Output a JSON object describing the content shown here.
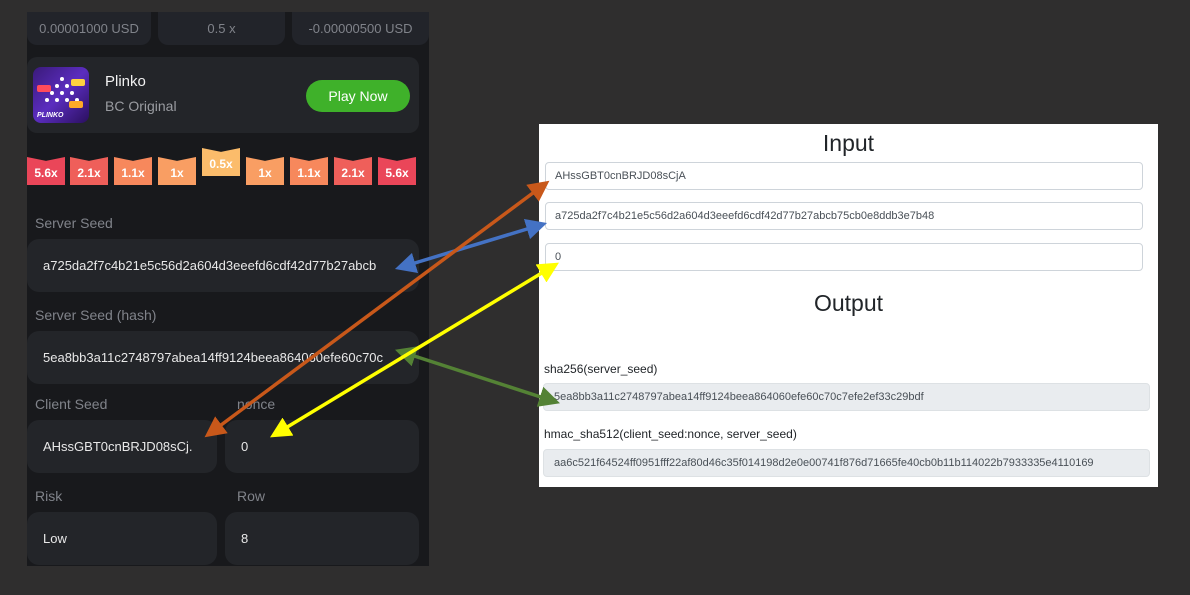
{
  "stats": [
    "0.00001000 USD",
    "0.5 x",
    "-0.00000500 USD"
  ],
  "game": {
    "thumb_label": "PLINKO",
    "title": "Plinko",
    "subtitle": "BC Original",
    "play_label": "Play Now"
  },
  "multipliers": [
    {
      "label": "5.6x",
      "color": "#ea4659"
    },
    {
      "label": "2.1x",
      "color": "#ef5f5a"
    },
    {
      "label": "1.1x",
      "color": "#f7885c"
    },
    {
      "label": "1x",
      "color": "#f99e63"
    },
    {
      "label": "0.5x",
      "color": "#fbbc6b"
    },
    {
      "label": "1x",
      "color": "#f99e63"
    },
    {
      "label": "1.1x",
      "color": "#f7885c"
    },
    {
      "label": "2.1x",
      "color": "#ef5f5a"
    },
    {
      "label": "5.6x",
      "color": "#ea4659"
    }
  ],
  "fields": {
    "server_seed_label": "Server Seed",
    "server_seed_value": "a725da2f7c4b21e5c56d2a604d3eeefd6cdf42d77b27abcb",
    "server_seed_hash_label": "Server Seed (hash)",
    "server_seed_hash_value": "5ea8bb3a11c2748797abea14ff9124beea864060efe60c70c",
    "client_seed_label": "Client Seed",
    "client_seed_value": "AHssGBT0cnBRJD08sCj.",
    "nonce_label": "nonce",
    "nonce_value": "0",
    "risk_label": "Risk",
    "risk_value": "Low",
    "row_label": "Row",
    "row_value": "8"
  },
  "verifier": {
    "input_heading": "Input",
    "client_seed": "AHssGBT0cnBRJD08sCjA",
    "server_seed": "a725da2f7c4b21e5c56d2a604d3eeefd6cdf42d77b27abcb75cb0e8ddb3e7b48",
    "nonce": "0",
    "output_heading": "Output",
    "sha256_label": "sha256(server_seed)",
    "sha256_value": "5ea8bb3a11c2748797abea14ff9124beea864060efe60c70c7efe2ef33c29bdf",
    "hmac_label": "hmac_sha512(client_seed:nonce, server_seed)",
    "hmac_value": "aa6c521f64524ff0951fff22af80d46c35f014198d2e0e00741f876d71665fe40cb0b11b114022b7933335e4110169"
  },
  "arrow_colors": {
    "client_seed": "#c8581a",
    "server_seed": "#4472c4",
    "nonce": "#ffff00",
    "hash": "#548235"
  }
}
